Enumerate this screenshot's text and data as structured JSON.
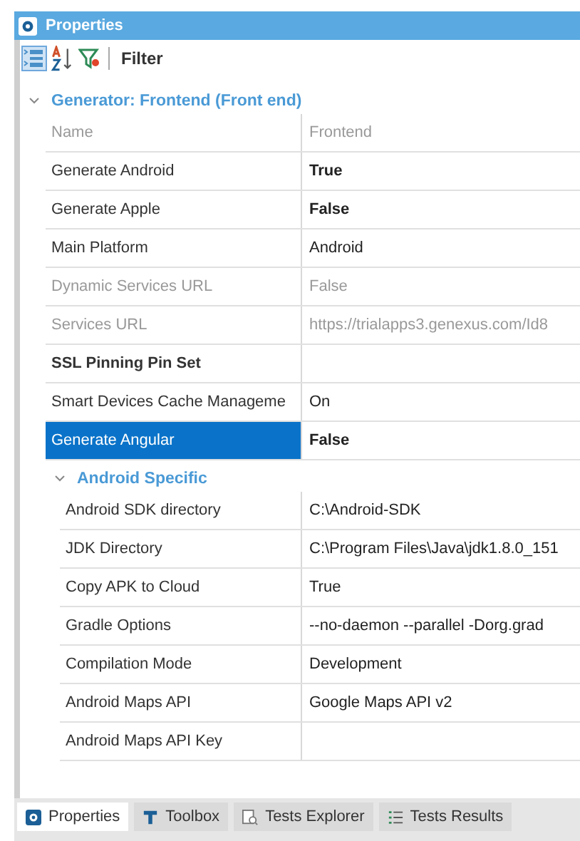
{
  "window": {
    "title": "Properties"
  },
  "toolbar": {
    "filter_label": "Filter"
  },
  "groups": [
    {
      "title": "Generator: Frontend (Front end)",
      "expanded": true,
      "rows": [
        {
          "name": "Name",
          "value": "Frontend",
          "disabled": true,
          "selected": false
        },
        {
          "name": "Generate Android",
          "value": "True",
          "disabled": false,
          "value_bold": true,
          "selected": false
        },
        {
          "name": "Generate Apple",
          "value": "False",
          "disabled": false,
          "value_bold": true,
          "selected": false
        },
        {
          "name": "Main Platform",
          "value": "Android",
          "disabled": false,
          "selected": false
        },
        {
          "name": "Dynamic Services URL",
          "value": "False",
          "disabled": true,
          "selected": false
        },
        {
          "name": "Services URL",
          "value": "https://trialapps3.genexus.com/Id8",
          "disabled": true,
          "selected": false
        },
        {
          "name": "SSL Pinning Pin Set",
          "disabled": false,
          "name_bold": true,
          "selected": false
        },
        {
          "name": "Smart Devices Cache Manageme",
          "value": "On",
          "disabled": false,
          "selected": false
        },
        {
          "name": "Generate Angular",
          "value": "False",
          "disabled": false,
          "value_bold": true,
          "selected": true
        }
      ],
      "children": [
        {
          "title": "Android Specific",
          "expanded": true,
          "rows": [
            {
              "name": "Android SDK directory",
              "value": "C:\\Android-SDK",
              "disabled": false,
              "selected": false
            },
            {
              "name": "JDK Directory",
              "value": "C:\\Program Files\\Java\\jdk1.8.0_151",
              "disabled": false,
              "selected": false
            },
            {
              "name": "Copy APK to Cloud",
              "value": "True",
              "disabled": false,
              "selected": false
            },
            {
              "name": "Gradle Options",
              "value": "--no-daemon --parallel -Dorg.grad",
              "disabled": false,
              "selected": false
            },
            {
              "name": "Compilation Mode",
              "value": "Development",
              "disabled": false,
              "selected": false
            },
            {
              "name": "Android Maps API",
              "value": "Google Maps API v2",
              "disabled": false,
              "selected": false
            },
            {
              "name": "Android Maps API Key",
              "disabled": false,
              "selected": false
            }
          ]
        }
      ]
    }
  ],
  "bottom_tabs": [
    {
      "label": "Properties",
      "kind": "properties",
      "selected": true
    },
    {
      "label": "Toolbox",
      "kind": "toolbox",
      "selected": false
    },
    {
      "label": "Tests Explorer",
      "kind": "explorer",
      "selected": false
    },
    {
      "label": "Tests Results",
      "kind": "results",
      "selected": false
    }
  ]
}
